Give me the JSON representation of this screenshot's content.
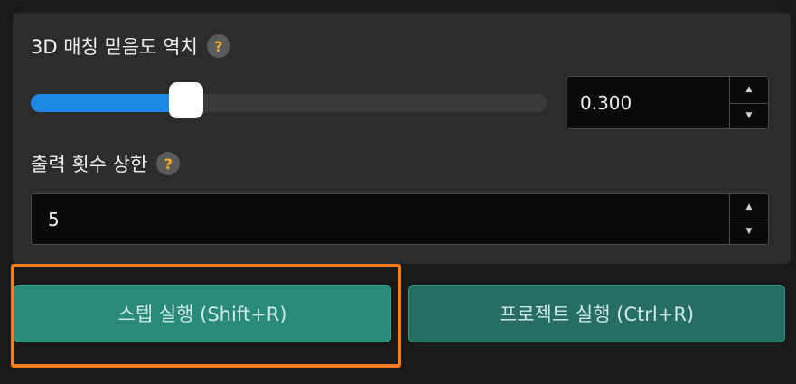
{
  "threshold": {
    "label": "3D 매칭 믿음도 역치",
    "help_glyph": "?",
    "value": "0.300",
    "slider_fraction": 0.3
  },
  "output_limit": {
    "label": "출력 횟수 상한",
    "help_glyph": "?",
    "value": "5"
  },
  "spin": {
    "up_glyph": "▲",
    "down_glyph": "▼"
  },
  "buttons": {
    "step_run": "스텝 실행 (Shift+R)",
    "project_run": "프로젝트 실행 (Ctrl+R)"
  },
  "colors": {
    "accent_blue": "#1e88e5",
    "button_teal": "#2a8a78",
    "highlight_orange": "#f47e1f"
  }
}
